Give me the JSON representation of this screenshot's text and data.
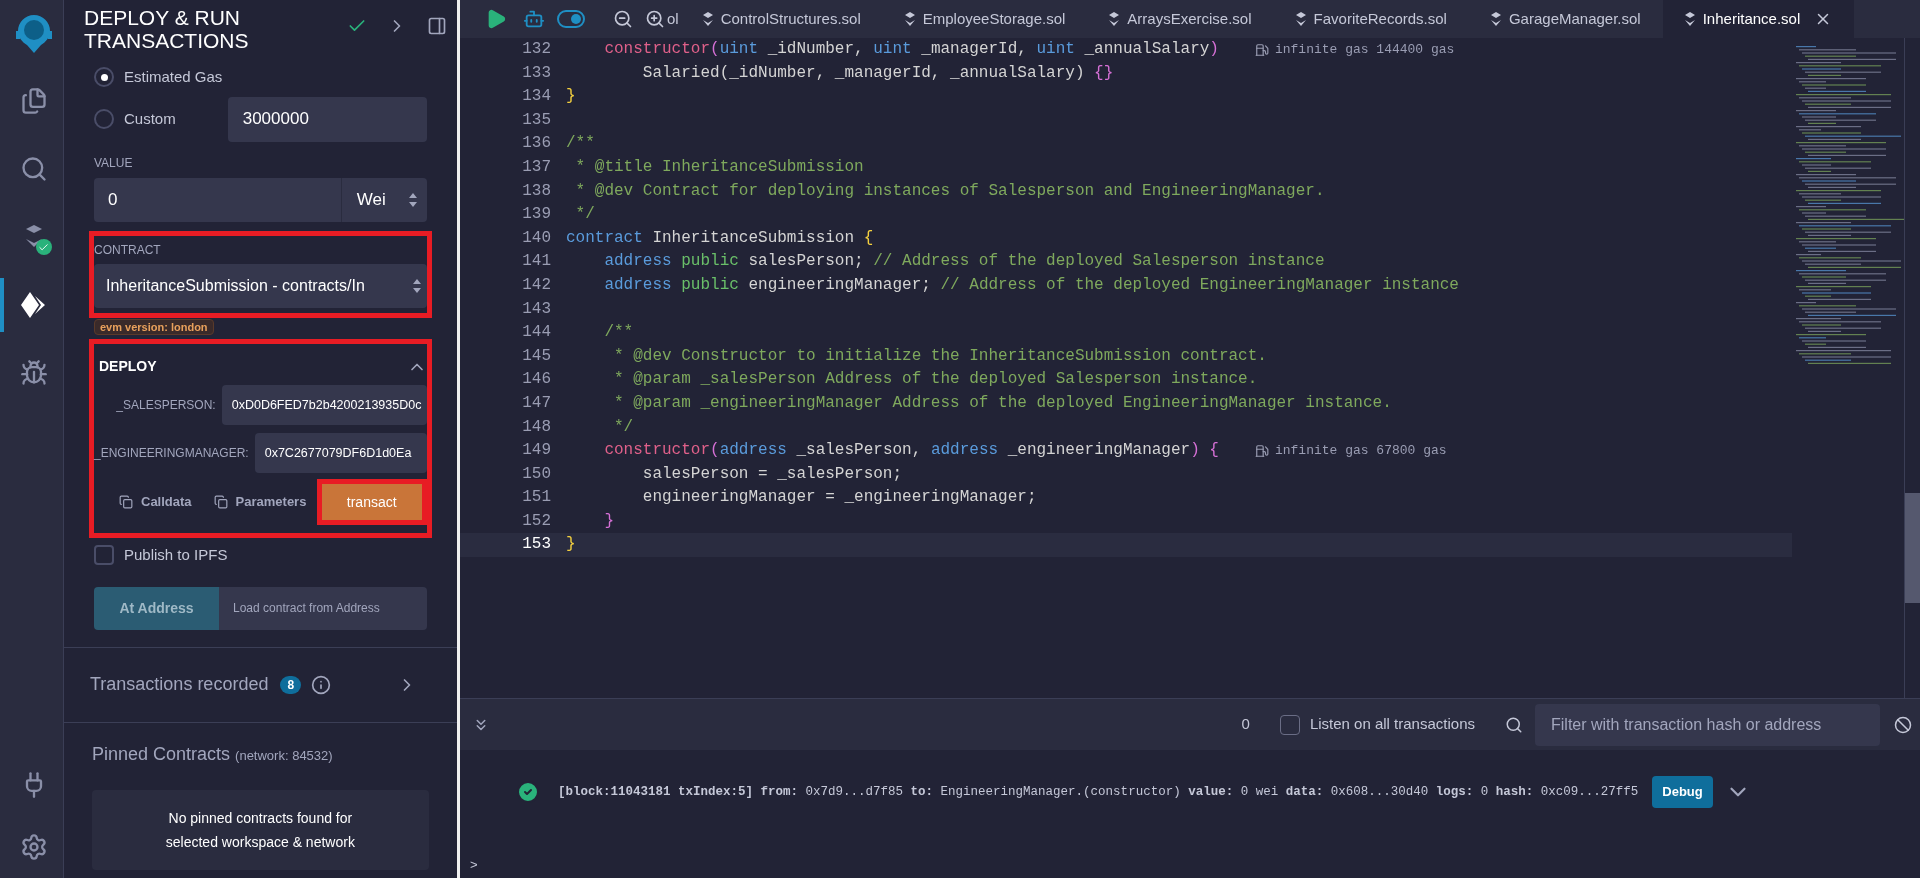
{
  "activity_bar": [
    {
      "kind": "logo",
      "selected": false
    },
    {
      "kind": "files",
      "selected": false
    },
    {
      "kind": "search",
      "selected": false
    },
    {
      "kind": "compiler",
      "selected": false,
      "badge": true
    },
    {
      "kind": "deploy",
      "selected": true
    },
    {
      "kind": "debugger",
      "selected": false
    },
    {
      "kind": "plugins",
      "selected": false
    },
    {
      "kind": "settings",
      "selected": false
    }
  ],
  "panel": {
    "title": "DEPLOY & RUN TRANSACTIONS",
    "gas_options": [
      {
        "label": "Estimated Gas",
        "selected": true
      },
      {
        "label": "Custom",
        "selected": false
      }
    ],
    "gas_limit_value": "3000000",
    "value": {
      "label": "VALUE",
      "amount": "0",
      "unit": "Wei"
    },
    "contract": {
      "label": "CONTRACT",
      "selected_contract": "InheritanceSubmission - contracts/In",
      "highlighted": true
    },
    "evm_badge": "evm version: london",
    "deploy": {
      "title": "DEPLOY",
      "expanded": true,
      "highlighted": true,
      "params": [
        {
          "label": "_SALESPERSON:",
          "value": "0xD0D6FED7b2b4200213935D0c"
        },
        {
          "label": "_ENGINEERINGMANAGER:",
          "value": "0x7C2677079DF6D1d0Ea"
        }
      ],
      "calldata": "Calldata",
      "parameters": "Parameters",
      "transact": {
        "label": "transact",
        "highlighted": true
      }
    },
    "publish_ipfs": {
      "label": "Publish to IPFS",
      "checked": false
    },
    "at_address": {
      "button": "At Address",
      "placeholder": "Load contract from Address"
    },
    "transactions_recorded": {
      "label": "Transactions recorded",
      "count": "8"
    },
    "pinned": {
      "title": "Pinned Contracts",
      "network": "(network: 84532)",
      "empty": "No pinned contracts found for selected workspace & network"
    }
  },
  "tabs": [
    {
      "label": "ol",
      "selected": false,
      "closable": false
    },
    {
      "label": "ControlStructures.sol",
      "selected": false,
      "closable": false
    },
    {
      "label": "EmployeeStorage.sol",
      "selected": false,
      "closable": false
    },
    {
      "label": "ArraysExercise.sol",
      "selected": false,
      "closable": false
    },
    {
      "label": "FavoriteRecords.sol",
      "selected": false,
      "closable": false
    },
    {
      "label": "GarageManager.sol",
      "selected": false,
      "closable": false
    },
    {
      "label": "Inheritance.sol",
      "selected": true,
      "closable": true
    }
  ],
  "toolbar": {
    "autocompile_on": true
  },
  "code": [
    {
      "number": "132",
      "current": false,
      "segments": [
        {
          "kind": "func",
          "text": "    constructor"
        },
        {
          "kind": "brace2",
          "text": "("
        },
        {
          "kind": "kw",
          "text": "uint"
        },
        {
          "kind": "plain",
          "text": " _idNumber, "
        },
        {
          "kind": "kw",
          "text": "uint"
        },
        {
          "kind": "plain",
          "text": " _managerId, "
        },
        {
          "kind": "kw",
          "text": "uint"
        },
        {
          "kind": "plain",
          "text": " _annualSalary"
        },
        {
          "kind": "brace2",
          "text": ")"
        }
      ],
      "gas_hint": "infinite gas 144400 gas"
    },
    {
      "number": "133",
      "current": false,
      "segments": [
        {
          "kind": "plain",
          "text": "        Salaried(_idNumber, _managerId, _annualSalary) "
        },
        {
          "kind": "brace2",
          "text": "{}"
        }
      ]
    },
    {
      "number": "134",
      "current": false,
      "segments": [
        {
          "kind": "brace",
          "text": "}"
        }
      ]
    },
    {
      "number": "135",
      "current": false
    },
    {
      "number": "136",
      "current": false,
      "segments": [
        {
          "kind": "comment",
          "text": "/**"
        }
      ]
    },
    {
      "number": "137",
      "current": false,
      "segments": [
        {
          "kind": "comment",
          "text": " * @title InheritanceSubmission"
        }
      ]
    },
    {
      "number": "138",
      "current": false,
      "segments": [
        {
          "kind": "comment",
          "text": " * @dev Contract for deploying instances of Salesperson and EngineeringManager."
        }
      ]
    },
    {
      "number": "139",
      "current": false,
      "segments": [
        {
          "kind": "comment",
          "text": " */"
        }
      ]
    },
    {
      "number": "140",
      "current": false,
      "segments": [
        {
          "kind": "kw",
          "text": "contract"
        },
        {
          "kind": "plain",
          "text": " InheritanceSubmission "
        },
        {
          "kind": "brace",
          "text": "{"
        }
      ]
    },
    {
      "number": "141",
      "current": false,
      "segments": [
        {
          "kind": "kw",
          "text": "    address "
        },
        {
          "kind": "mod",
          "text": "public"
        },
        {
          "kind": "plain",
          "text": " salesPerson; "
        },
        {
          "kind": "comment",
          "text": "// Address of the deployed Salesperson instance"
        }
      ]
    },
    {
      "number": "142",
      "current": false,
      "segments": [
        {
          "kind": "kw",
          "text": "    address "
        },
        {
          "kind": "mod",
          "text": "public"
        },
        {
          "kind": "plain",
          "text": " engineeringManager; "
        },
        {
          "kind": "comment",
          "text": "// Address of the deployed EngineeringManager instance"
        }
      ]
    },
    {
      "number": "143",
      "current": false
    },
    {
      "number": "144",
      "current": false,
      "segments": [
        {
          "kind": "comment",
          "text": "    /**"
        }
      ]
    },
    {
      "number": "145",
      "current": false,
      "segments": [
        {
          "kind": "comment",
          "text": "     * @dev Constructor to initialize the InheritanceSubmission contract."
        }
      ]
    },
    {
      "number": "146",
      "current": false,
      "segments": [
        {
          "kind": "comment",
          "text": "     * @param _salesPerson Address of the deployed Salesperson instance."
        }
      ]
    },
    {
      "number": "147",
      "current": false,
      "segments": [
        {
          "kind": "comment",
          "text": "     * @param _engineeringManager Address of the deployed EngineeringManager instance."
        }
      ]
    },
    {
      "number": "148",
      "current": false,
      "segments": [
        {
          "kind": "comment",
          "text": "     */"
        }
      ]
    },
    {
      "number": "149",
      "current": false,
      "segments": [
        {
          "kind": "func",
          "text": "    constructor"
        },
        {
          "kind": "brace2",
          "text": "("
        },
        {
          "kind": "kw",
          "text": "address"
        },
        {
          "kind": "plain",
          "text": " _salesPerson, "
        },
        {
          "kind": "kw",
          "text": "address"
        },
        {
          "kind": "plain",
          "text": " _engineeringManager"
        },
        {
          "kind": "brace2",
          "text": ") {"
        }
      ],
      "gas_hint": "infinite gas 67800 gas"
    },
    {
      "number": "150",
      "current": false,
      "segments": [
        {
          "kind": "plain",
          "text": "        salesPerson = _salesPerson;"
        }
      ]
    },
    {
      "number": "151",
      "current": false,
      "segments": [
        {
          "kind": "plain",
          "text": "        engineeringManager = _engineeringManager;"
        }
      ]
    },
    {
      "number": "152",
      "current": false,
      "segments": [
        {
          "kind": "brace2",
          "text": "    }"
        }
      ]
    },
    {
      "number": "153",
      "current": true,
      "segments": [
        {
          "kind": "brace",
          "text": "}"
        }
      ]
    }
  ],
  "terminal": {
    "count": "0",
    "listen": {
      "label": "Listen on all transactions",
      "checked": false
    },
    "filter_placeholder": "Filter with transaction hash or address",
    "logs": [
      {
        "success": true,
        "text": "**[block:11043181 txIndex:5]  from:** 0x7d9...d7f85 **to:** EngineeringManager.(constructor) **value:** 0 wei **data:** 0x608...30d40 **logs:** 0 **hash:** 0xc09...27ff5",
        "action": "Debug"
      }
    ],
    "prompt": ">"
  }
}
